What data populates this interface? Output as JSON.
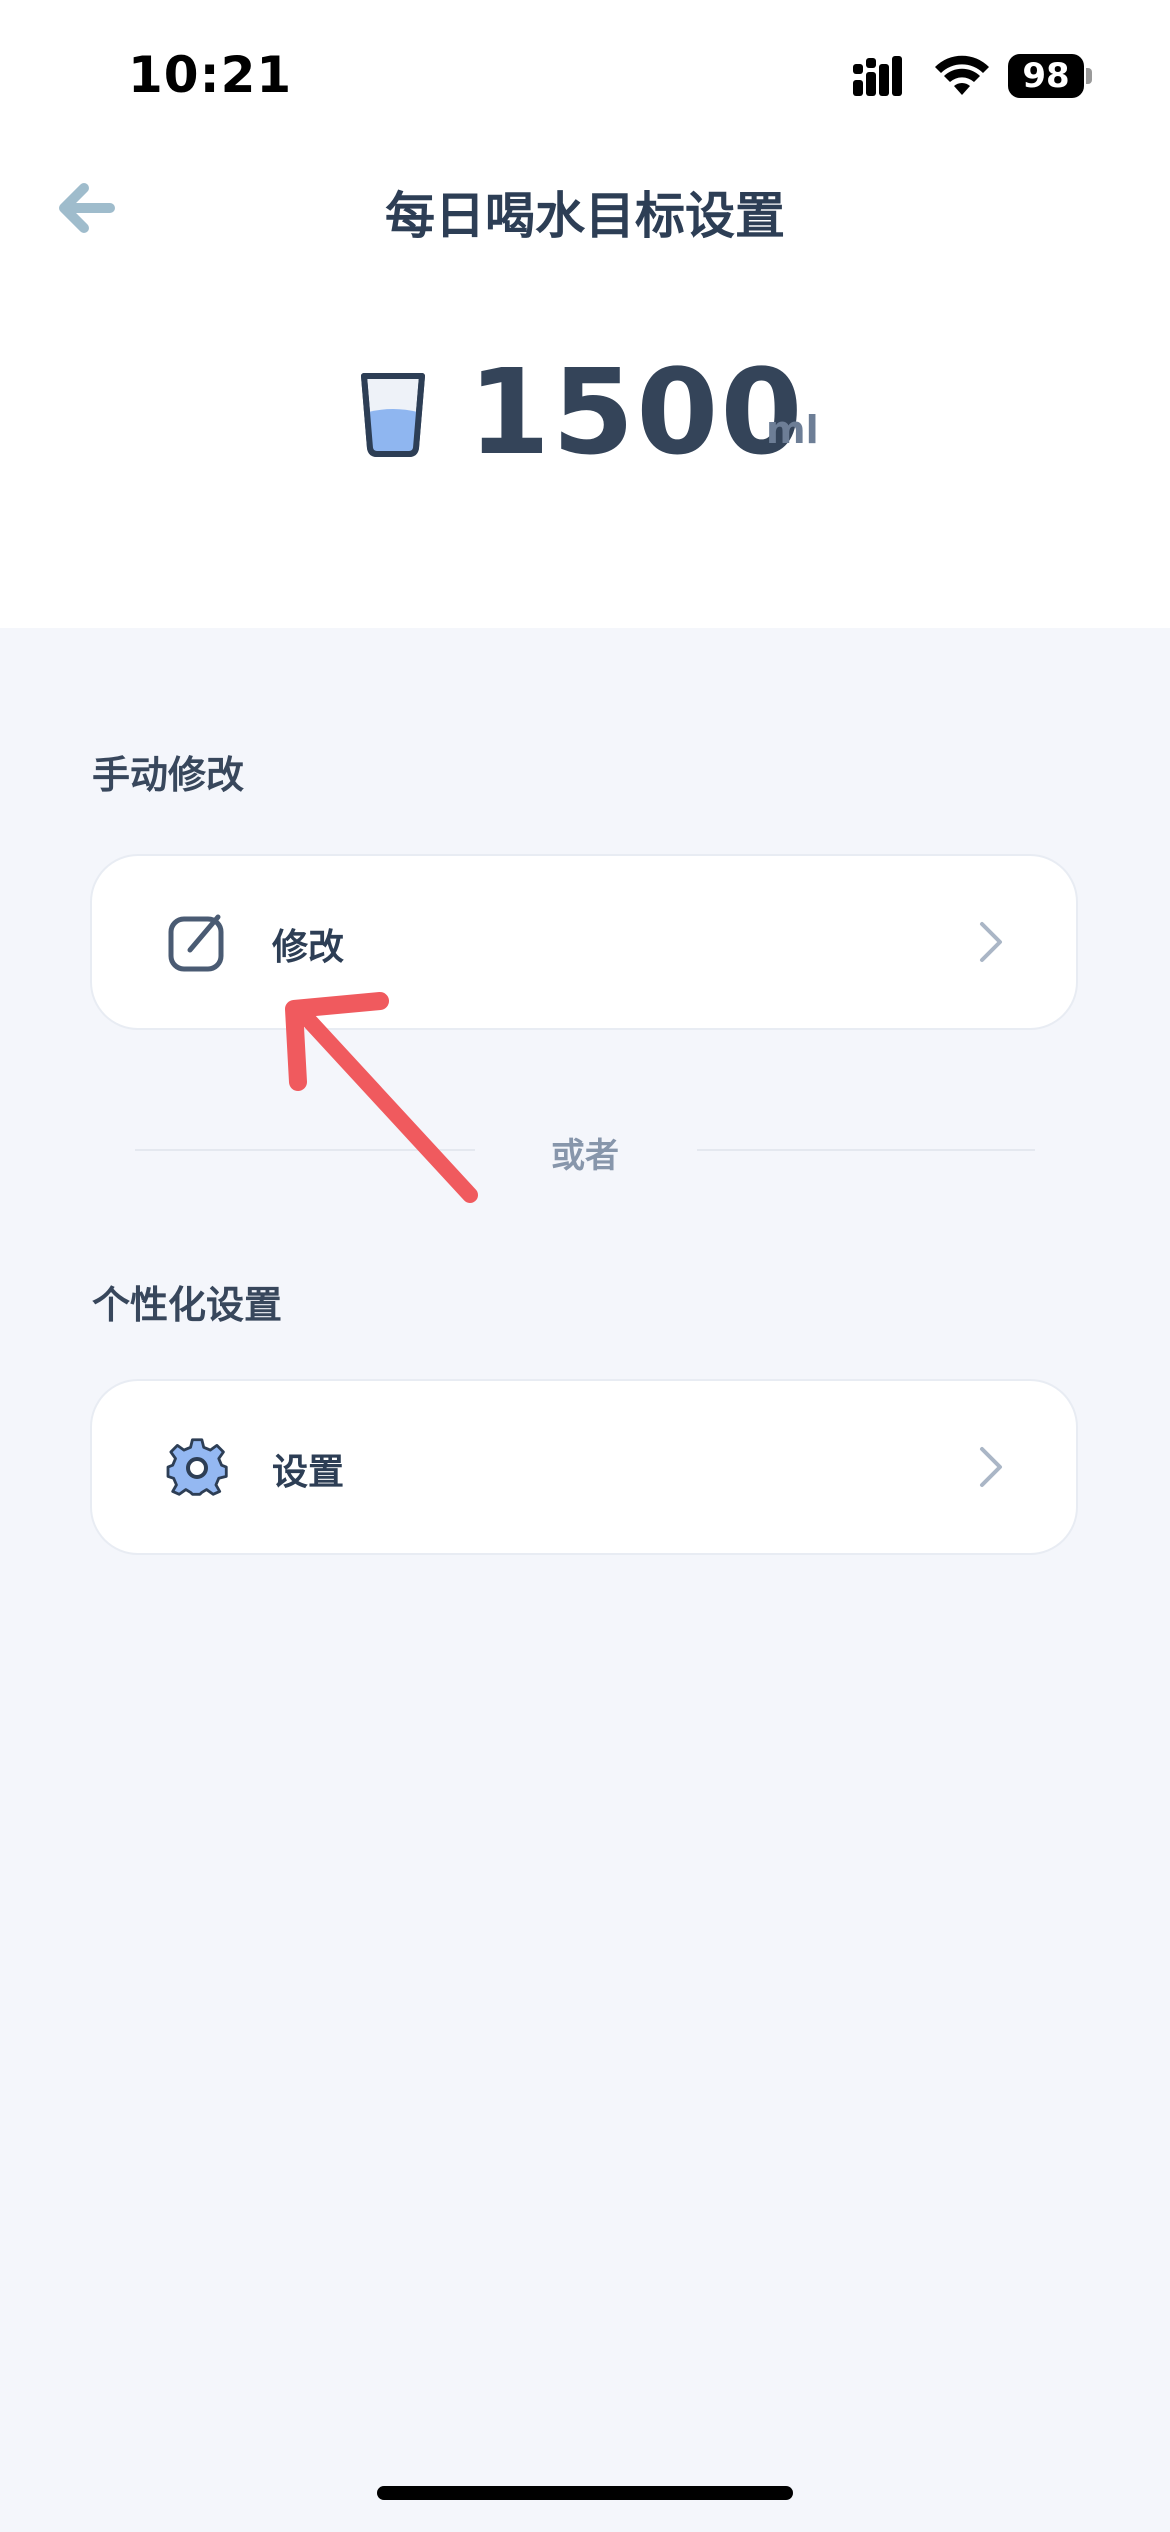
{
  "status_bar": {
    "time": "10:21",
    "battery": "98"
  },
  "header": {
    "title": "每日喝水目标设置"
  },
  "goal": {
    "value": "1500",
    "unit": "ml"
  },
  "manual": {
    "section_title": "手动修改",
    "item_label": "修改"
  },
  "divider": {
    "text": "或者"
  },
  "personal": {
    "section_title": "个性化设置",
    "item_label": "设置"
  },
  "colors": {
    "background": "#f4f6fb",
    "card": "#ffffff",
    "accent": "#94b8f2",
    "annotation_arrow": "#f05a5e"
  },
  "icons": [
    "back-arrow-icon",
    "water-cup-icon",
    "edit-icon",
    "gear-icon",
    "chevron-right-icon"
  ]
}
